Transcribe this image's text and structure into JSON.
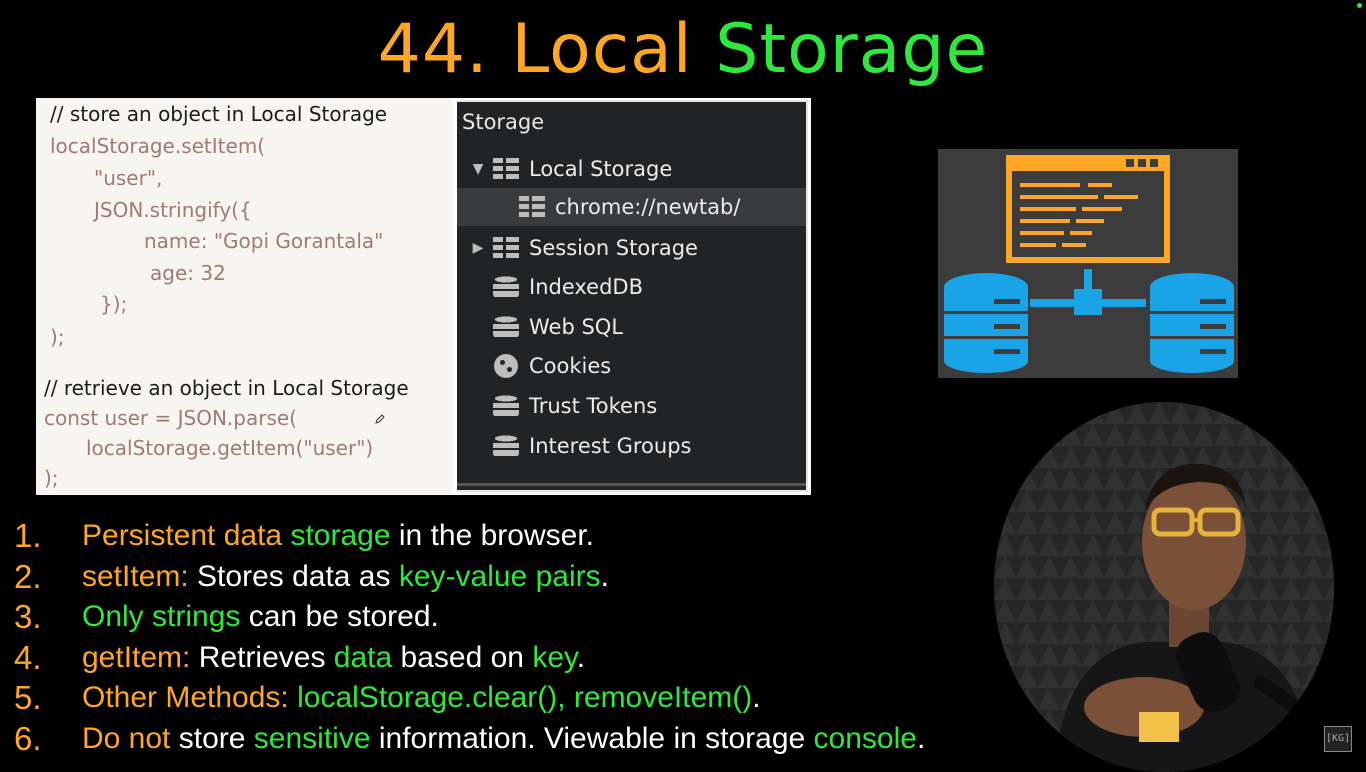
{
  "title": {
    "number": "44.",
    "word1": "Local",
    "word2": "Storage"
  },
  "code_panel": {
    "lines": [
      "// store an object in Local Storage",
      "localStorage.setItem(",
      "\"user\",",
      "JSON.stringify({",
      "name: \"Gopi Gorantala\"",
      "age: 32",
      "});",
      ");",
      "// retrieve an object in Local Storage",
      "const user = JSON.parse(",
      "localStorage.getItem(\"user\")",
      ");"
    ]
  },
  "devtools": {
    "header": "Storage",
    "items": [
      {
        "label": "Local Storage",
        "icon": "grid-icon",
        "expanded": true
      },
      {
        "label": "chrome://newtab/",
        "icon": "grid-icon",
        "selected": true
      },
      {
        "label": "Session Storage",
        "icon": "grid-icon",
        "expanded": false
      },
      {
        "label": "IndexedDB",
        "icon": "database-icon"
      },
      {
        "label": "Web SQL",
        "icon": "database-icon"
      },
      {
        "label": "Cookies",
        "icon": "cookie-icon"
      },
      {
        "label": "Trust Tokens",
        "icon": "database-icon"
      },
      {
        "label": "Interest Groups",
        "icon": "database-icon"
      }
    ]
  },
  "bullets": [
    {
      "num": "1.",
      "parts": [
        "Persistent data",
        "storage",
        "in the browser."
      ]
    },
    {
      "num": "2.",
      "parts": [
        "setItem:",
        "Stores data as",
        "key-value pairs",
        "."
      ]
    },
    {
      "num": "3.",
      "parts": [
        "Only strings",
        "can be stored."
      ]
    },
    {
      "num": "4.",
      "parts": [
        "getItem:",
        "Retrieves",
        "data",
        "based on",
        "key",
        "."
      ]
    },
    {
      "num": "5.",
      "parts": [
        "Other Methods:",
        "localStorage.clear(), removeItem()",
        "."
      ]
    },
    {
      "num": "6.",
      "parts": [
        "Do not",
        "store",
        "sensitive",
        "information. Viewable in storage",
        "console",
        "."
      ]
    }
  ],
  "logo_text": "[KG]",
  "colors": {
    "orange": "#ffa724",
    "green": "#2ee83b",
    "background": "#000000"
  }
}
